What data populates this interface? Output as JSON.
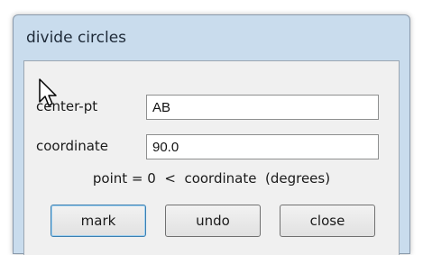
{
  "window": {
    "title": "divide circles"
  },
  "form": {
    "center_label": "center-pt",
    "center_value": "AB",
    "coordinate_label": "coordinate",
    "coordinate_value": "90.0",
    "info_text": "point = 0  <  coordinate  (degrees)"
  },
  "buttons": {
    "mark": "mark",
    "undo": "undo",
    "close": "close"
  },
  "icons": {
    "pointer": "mouse-pointer-icon"
  }
}
